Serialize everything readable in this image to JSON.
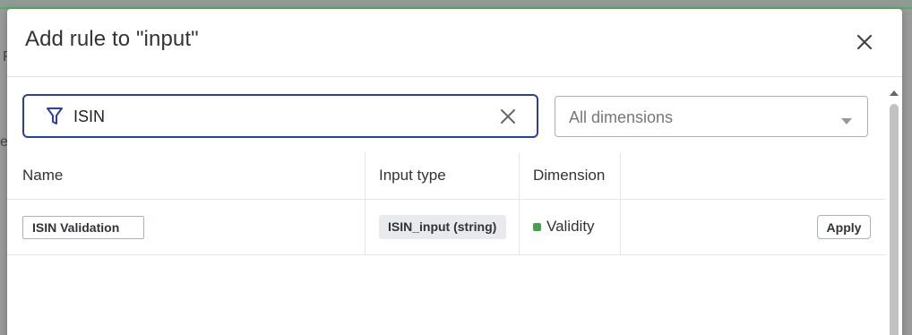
{
  "background": {
    "fragment_1": "F",
    "fragment_2": "er"
  },
  "modal": {
    "title": "Add rule to \"input\"",
    "close_icon": "close-icon"
  },
  "search": {
    "value": "ISIN",
    "filter_icon": "filter-icon",
    "clear_icon": "clear-icon"
  },
  "dimension_filter": {
    "selected": "All dimensions",
    "caret_icon": "caret-down-icon"
  },
  "table": {
    "columns": [
      "Name",
      "Input type",
      "Dimension"
    ],
    "rows": [
      {
        "name": "ISIN Validation",
        "input_type": "ISIN_input (string)",
        "dimension": "Validity",
        "dimension_color": "#45a347",
        "action": "Apply"
      }
    ]
  },
  "colors": {
    "accent_border": "#2b3ea5",
    "validity_green": "#45a347"
  }
}
